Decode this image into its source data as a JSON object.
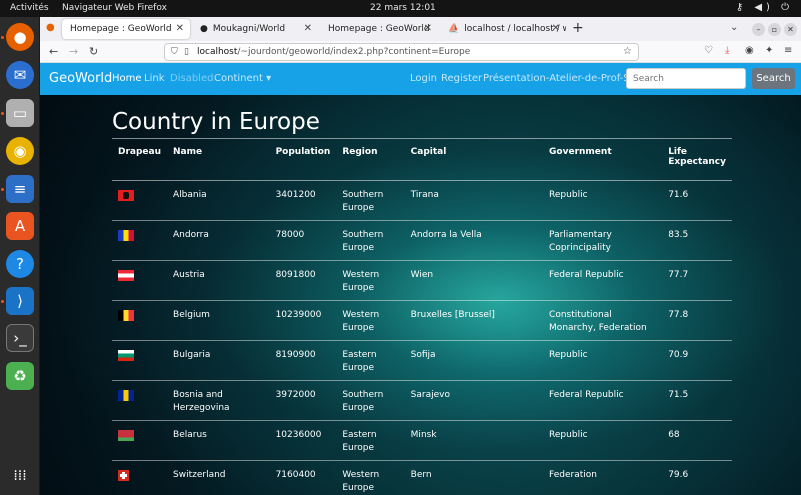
{
  "topbar": {
    "activities": "Activités",
    "app_name": "Navigateur Web Firefox",
    "clock": "22 mars  12:01"
  },
  "tabs": [
    {
      "label": "Homepage : GeoWorld",
      "active": true,
      "icon": "firefox-icon"
    },
    {
      "label": "Moukagni/World",
      "active": false,
      "icon": "github-icon"
    },
    {
      "label": "Homepage : GeoWorld",
      "active": false,
      "icon": "none"
    },
    {
      "label": "localhost / localhost / w",
      "active": false,
      "icon": "phpmyadmin-icon"
    }
  ],
  "url": {
    "host": "localhost",
    "path": "/~jourdont/geoworld/index2.php?continent=Europe"
  },
  "site_nav": {
    "brand": "GeoWorld",
    "home": "Home",
    "link": "Link",
    "disabled": "Disabled",
    "continent": "Continent ▾",
    "login": "Login",
    "register": "Register",
    "presentation": "Présentation-Atelier-de-Prof-SLAM",
    "search_placeholder": "Search",
    "search_button": "Search"
  },
  "heading": "Country in Europe",
  "table": {
    "headers": [
      "Drapeau",
      "Name",
      "Population",
      "Region",
      "Capital",
      "Government",
      "Life Expectancy"
    ],
    "rows": [
      {
        "flag": [
          "#e41e20",
          "#e41e20",
          "#e41e20"
        ],
        "name": "Albania",
        "population": "3401200",
        "region": "Southern Europe",
        "capital": "Tirana",
        "government": "Republic",
        "life": "71.6"
      },
      {
        "flag": [
          "#1a3bbf",
          "#fedf00",
          "#d0103a"
        ],
        "name": "Andorra",
        "population": "78000",
        "region": "Southern Europe",
        "capital": "Andorra la Vella",
        "government": "Parliamentary Coprincipality",
        "life": "83.5"
      },
      {
        "flag": [
          "#ed2939",
          "#ffffff",
          "#ed2939"
        ],
        "name": "Austria",
        "population": "8091800",
        "region": "Western Europe",
        "capital": "Wien",
        "government": "Federal Republic",
        "life": "77.7"
      },
      {
        "flag": [
          "#000000",
          "#fdda24",
          "#ef3340"
        ],
        "name": "Belgium",
        "population": "10239000",
        "region": "Western Europe",
        "capital": "Bruxelles [Brussel]",
        "government": "Constitutional Monarchy, Federation",
        "life": "77.8"
      },
      {
        "flag": [
          "#ffffff",
          "#00966e",
          "#d62612"
        ],
        "name": "Bulgaria",
        "population": "8190900",
        "region": "Eastern Europe",
        "capital": "Sofija",
        "government": "Republic",
        "life": "70.9"
      },
      {
        "flag": [
          "#002395",
          "#fecb00",
          "#002395"
        ],
        "name": "Bosnia and Herzegovina",
        "population": "3972000",
        "region": "Southern Europe",
        "capital": "Sarajevo",
        "government": "Federal Republic",
        "life": "71.5"
      },
      {
        "flag": [
          "#c8313e",
          "#c8313e",
          "#4aa657"
        ],
        "name": "Belarus",
        "population": "10236000",
        "region": "Eastern Europe",
        "capital": "Minsk",
        "government": "Republic",
        "life": "68"
      },
      {
        "flag": [
          "#d52b1e",
          "#d52b1e",
          "#d52b1e"
        ],
        "name": "Switzerland",
        "population": "7160400",
        "region": "Western Europe",
        "capital": "Bern",
        "government": "Federation",
        "life": "79.6"
      }
    ]
  }
}
